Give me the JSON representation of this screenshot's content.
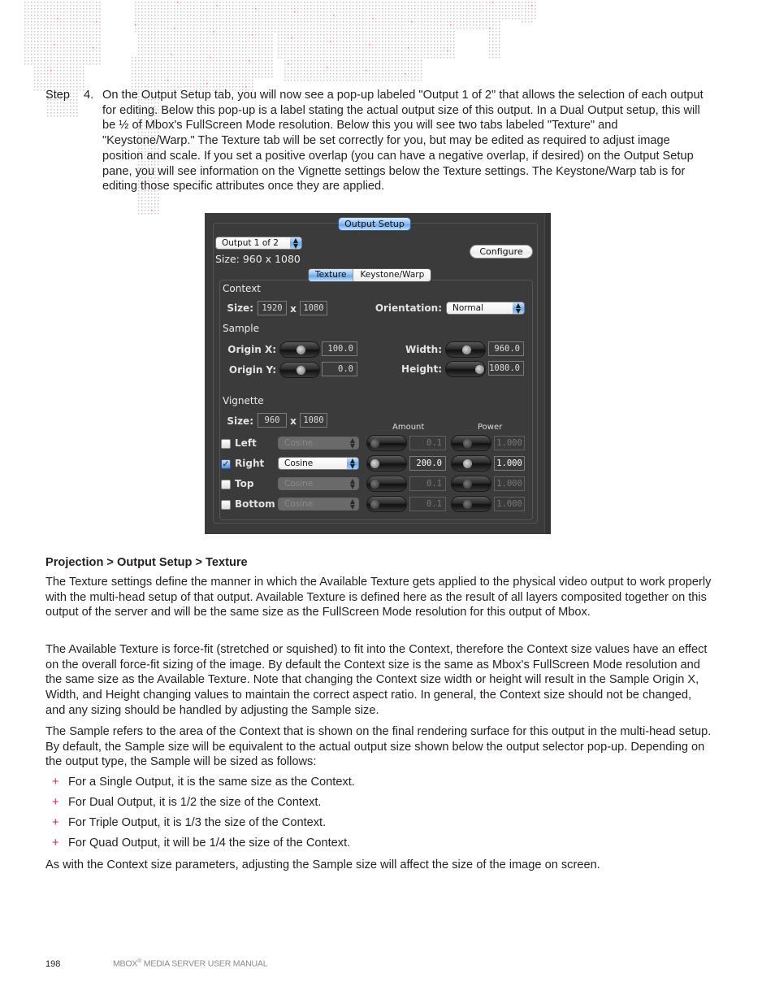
{
  "step": {
    "label": "Step",
    "number": "4.",
    "text": "On the Output Setup tab, you will now see a pop-up labeled \"Output 1 of 2\" that allows the selection of each output for editing. Below this pop-up is a label stating the actual output size of this output. In a Dual Output setup, this will be ½ of Mbox's FullScreen Mode resolution. Below this you will see two tabs labeled \"Texture\" and \"Keystone/Warp.\" The Texture tab will be set correctly for you, but may be edited as required to adjust image position and scale. If you set a positive overlap (you can have a negative overlap, if desired) on the Output Setup pane, you will see information on the Vignette settings below the Texture settings. The Keystone/Warp tab is for editing those specific attributes once they are applied."
  },
  "ui": {
    "top_tab": "Output Setup",
    "output_popup": "Output 1 of 2",
    "output_size": "Size: 960 x 1080",
    "configure_button": "Configure",
    "tabs": [
      {
        "label": "Texture",
        "active": true
      },
      {
        "label": "Keystone/Warp",
        "active": false
      }
    ],
    "context": {
      "heading": "Context",
      "size_label": "Size:",
      "width": "1920",
      "x": "x",
      "height": "1080",
      "orientation_label": "Orientation:",
      "orientation_value": "Normal"
    },
    "sample": {
      "heading": "Sample",
      "origin_x_label": "Origin X:",
      "origin_x_value": "100.0",
      "origin_x_slider": 0.5,
      "origin_y_label": "Origin Y:",
      "origin_y_value": "0.0",
      "origin_y_slider": 0.5,
      "width_label": "Width:",
      "width_value": "960.0",
      "width_slider": 0.5,
      "height_label": "Height:",
      "height_value": "1080.0",
      "height_slider": 1.0
    },
    "vignette": {
      "heading": "Vignette",
      "size_label": "Size:",
      "width": "960",
      "x": "x",
      "height": "1080",
      "amount_header": "Amount",
      "power_header": "Power",
      "rows": [
        {
          "label": "Left",
          "checked": false,
          "curve": "Cosine",
          "amount": "0.1",
          "power": "1.000"
        },
        {
          "label": "Right",
          "checked": true,
          "curve": "Cosine",
          "amount": "200.0",
          "power": "1.000"
        },
        {
          "label": "Top",
          "checked": false,
          "curve": "Cosine",
          "amount": "0.1",
          "power": "1.000"
        },
        {
          "label": "Bottom",
          "checked": false,
          "curve": "Cosine",
          "amount": "0.1",
          "power": "1.000"
        }
      ]
    }
  },
  "section": {
    "heading": "Projection > Output Setup > Texture",
    "paragraphs": [
      "The Texture settings define the manner in which the Available Texture gets applied to the physical video output to work properly with the multi-head setup of that output. Available Texture is defined here as the result of all layers composited together on this output of the server and will be the same size as the FullScreen Mode resolution for this output of Mbox.",
      "The Available Texture is force-fit (stretched or squished) to fit into the Context, therefore the Context size values have an effect on the overall force-fit sizing of the image. By default the Context size is the same as Mbox's FullScreen Mode resolution and the same size as the Available Texture. Note that changing the Context size width or height will result in the Sample Origin X, Width, and Height changing values to maintain the correct aspect ratio. In general, the Context size should not be changed, and any sizing should be handled by adjusting the Sample size.",
      "The Sample refers to the area of the Context that is shown on the final rendering surface for this output in the multi-head setup. By default, the Sample size will be equivalent to the actual output size shown below the output selector pop-up. Depending on the output type, the Sample will be sized as follows:"
    ],
    "bullet_marker": "+",
    "bullets": [
      "For a Single Output, it is the same size as the Context.",
      "For Dual Output, it is 1/2 the size of the Context.",
      "For Triple Output, it is 1/3 the size of the Context.",
      "For Quad Output, it will be 1/4 the size of the Context."
    ],
    "closing": "As with the Context size parameters, adjusting the Sample size will affect the size of the image on screen."
  },
  "footer": {
    "page_number": "198",
    "title_prefix": "MBOX",
    "title_reg": "®",
    "title_suffix": " MEDIA SERVER USER MANUAL"
  },
  "colors": {
    "accent_plus": "#c8285a",
    "map_dots": "#c9c9c9",
    "map_highlight": "#e8686a"
  }
}
